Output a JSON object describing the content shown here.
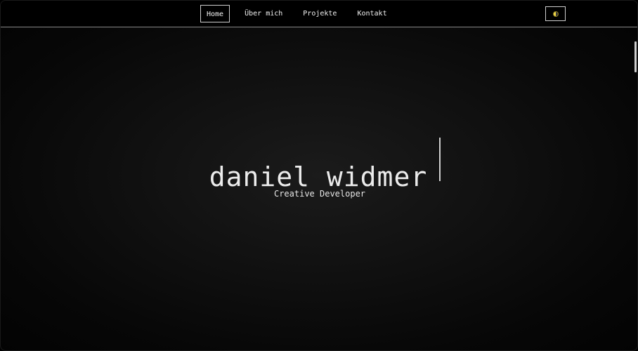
{
  "nav": {
    "items": [
      {
        "label": "Home",
        "active": true
      },
      {
        "label": "Über mich",
        "active": false
      },
      {
        "label": "Projekte",
        "active": false
      },
      {
        "label": "Kontakt",
        "active": false
      }
    ],
    "theme_toggle_icon": "half-moon-icon"
  },
  "hero": {
    "title": "daniel widmer",
    "subtitle": "Creative Developer"
  },
  "colors": {
    "background": "#000000",
    "text": "#ececec",
    "accent": "#f2d94a"
  }
}
